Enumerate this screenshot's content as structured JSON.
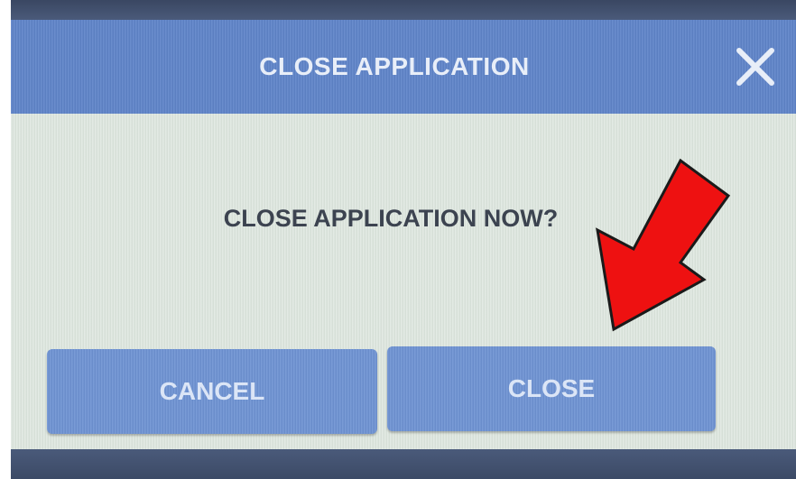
{
  "dialog": {
    "title": "CLOSE APPLICATION",
    "message": "CLOSE APPLICATION NOW?",
    "cancel_label": "CANCEL",
    "close_label": "CLOSE"
  },
  "icons": {
    "close": "close-icon",
    "annotation": "red-arrow-annotation"
  },
  "colors": {
    "header": "#5f84c9",
    "button": "#6e93d3",
    "body": "#dde6de",
    "arrow": "#ee1111"
  }
}
